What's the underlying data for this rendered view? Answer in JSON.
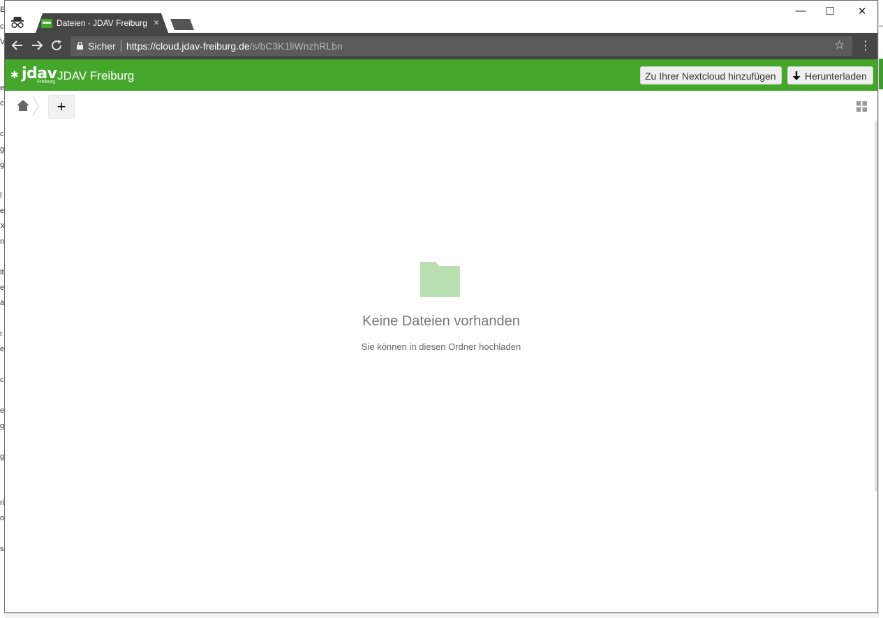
{
  "browser": {
    "tab_title": "Dateien - JDAV Freiburg",
    "tab_close": "×",
    "security_label": "Sicher",
    "url_scheme": "https://",
    "url_host": "cloud.jdav-freiburg.de",
    "url_path": "/s/bC3K1liWnzhRLbn",
    "controls": {
      "minimize": "—",
      "maximize": "☐",
      "close": "✕"
    }
  },
  "header": {
    "logo_text": "jdav",
    "logo_subtext": "Freiburg",
    "site_name": "JDAV Freiburg",
    "add_to_nextcloud_label": "Zu Ihrer Nextcloud hinzufügen",
    "download_label": "Herunterladen",
    "color": "#44a72c"
  },
  "controls": {
    "new_button_label": "+"
  },
  "empty_state": {
    "title": "Keine Dateien vorhanden",
    "hint": "Sie können in diesen Ordner hochladen",
    "folder_color": "#b9dfb0"
  }
}
